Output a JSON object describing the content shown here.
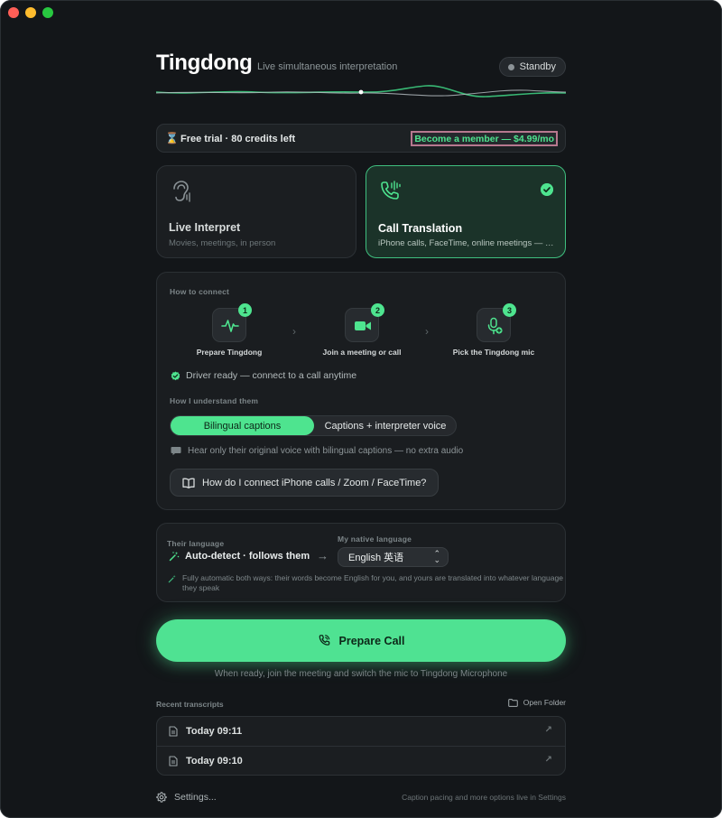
{
  "header": {
    "title": "Tingdong",
    "subtitle": "Live simultaneous interpretation",
    "status": "Standby"
  },
  "trial": {
    "text": "Free trial · 80 credits left",
    "member_button": "Become a member — $4.99/mo"
  },
  "modes": [
    {
      "title": "Live Interpret",
      "desc": "Movies, meetings, in person",
      "selected": false
    },
    {
      "title": "Call Translation",
      "desc": "iPhone calls, FaceTime, online meetings — two-way",
      "selected": true
    }
  ],
  "connect": {
    "label": "How to connect",
    "steps": [
      {
        "num": "1",
        "label": "Prepare Tingdong",
        "icon": "waveform-icon"
      },
      {
        "num": "2",
        "label": "Join a meeting or call",
        "icon": "video-icon"
      },
      {
        "num": "3",
        "label": "Pick the Tingdong mic",
        "icon": "mic-icon"
      }
    ],
    "driver_status": "Driver ready — connect to a call anytime",
    "understand_label": "How I understand them",
    "options": [
      "Bilingual captions",
      "Captions + interpreter voice"
    ],
    "selected_option": "Bilingual captions",
    "hint": "Hear only their original voice with bilingual captions — no extra audio",
    "faq_button": "How do I connect iPhone calls / Zoom / FaceTime?"
  },
  "language": {
    "their_label": "Their language",
    "their_value": "Auto-detect · follows them",
    "native_label": "My native language",
    "native_value": "English 英语",
    "note": "Fully automatic both ways: their words become English for you, and yours are translated into whatever language they speak"
  },
  "cta": {
    "label": "Prepare Call",
    "hint": "When ready, join the meeting and switch the mic to Tingdong Microphone"
  },
  "recent": {
    "label": "Recent transcripts",
    "open_folder": "Open Folder",
    "items": [
      "Today 09:11",
      "Today 09:10"
    ]
  },
  "footer": {
    "settings": "Settings...",
    "hint": "Caption pacing and more options live in Settings"
  },
  "colors": {
    "accent": "#4ee48f",
    "background": "#131619",
    "card": "#1a1d20",
    "selected_card": "#1b3329"
  }
}
